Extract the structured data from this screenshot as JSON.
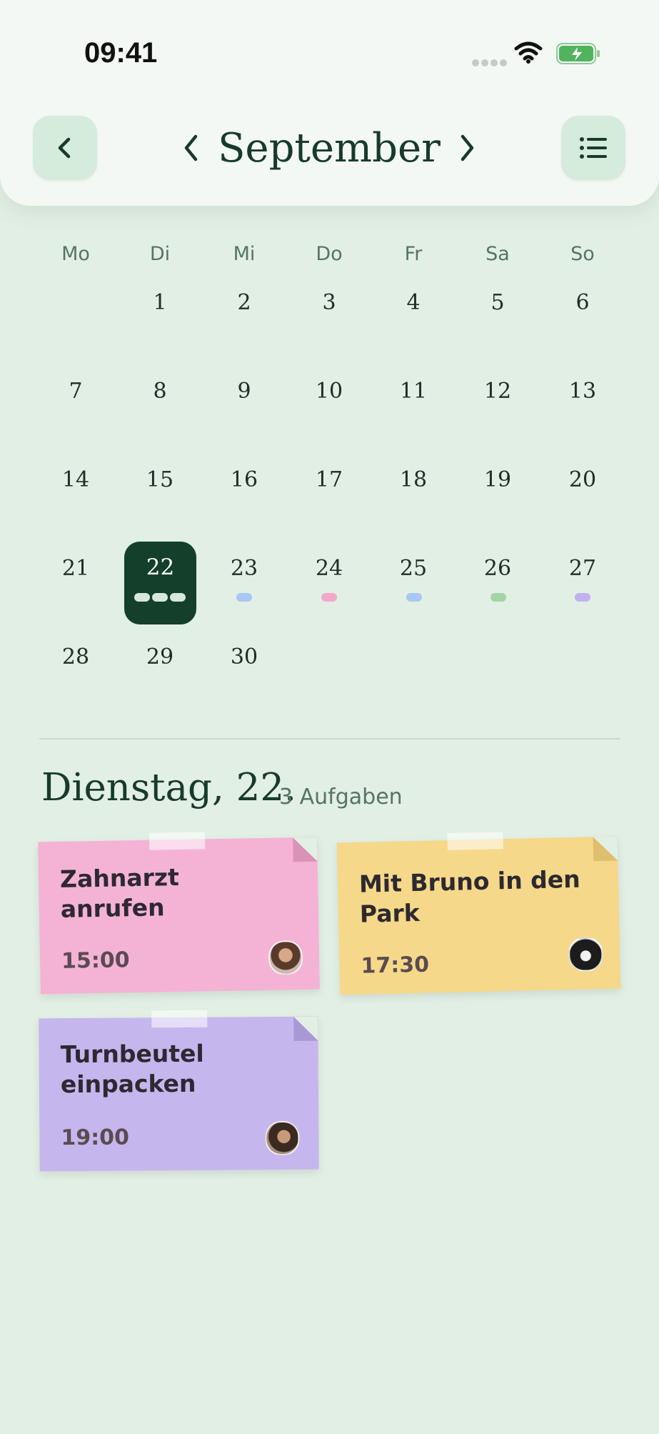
{
  "status_bar": {
    "time": "09:41"
  },
  "header": {
    "month": "September"
  },
  "weekdays": [
    "Mo",
    "Di",
    "Mi",
    "Do",
    "Fr",
    "Sa",
    "So"
  ],
  "days": [
    "1",
    "2",
    "3",
    "4",
    "5",
    "6",
    "7",
    "8",
    "9",
    "10",
    "11",
    "12",
    "13",
    "14",
    "15",
    "16",
    "17",
    "18",
    "19",
    "20",
    "21",
    "22",
    "23",
    "24",
    "25",
    "26",
    "27",
    "28",
    "29",
    "30"
  ],
  "selected_day": "22",
  "event_colors": {
    "blue": "#a7c8f2",
    "pink": "#f3a8c9",
    "green": "#a2d4a6",
    "purple": "#c3b1ef"
  },
  "selected_section": {
    "title": "Dienstag, 22.",
    "count": "3 Aufgaben"
  },
  "notes": [
    {
      "title": "Zahnarzt anrufen",
      "time": "15:00",
      "color": "#f4b3d5",
      "avatar": "girl-avatar"
    },
    {
      "title": "Mit Bruno in den Park",
      "time": "17:30",
      "color": "#f5d889",
      "avatar": "dog-avatar"
    },
    {
      "title": "Turnbeutel einpacken",
      "time": "19:00",
      "color": "#c6b6ee",
      "avatar": "child-avatar"
    }
  ],
  "icons": [
    "back-icon",
    "chevron-left-icon",
    "chevron-right-icon",
    "list-icon",
    "wifi-icon",
    "battery-icon"
  ]
}
